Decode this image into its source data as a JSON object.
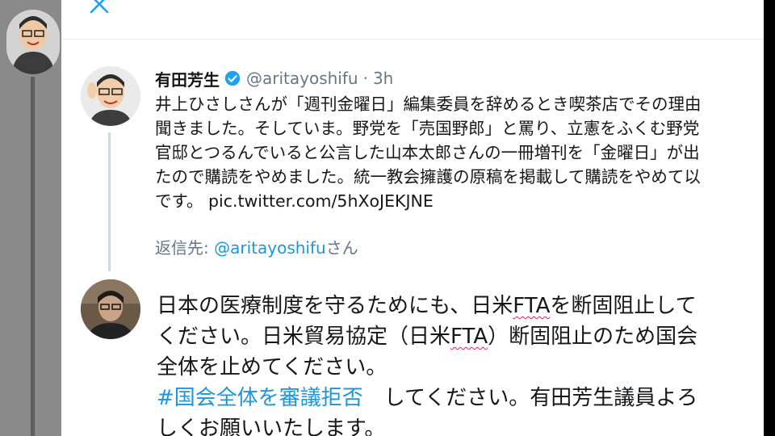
{
  "background": {
    "sidebar_avatar": "cartoon-avatar"
  },
  "modal": {
    "close_icon": "close-icon"
  },
  "tweet": {
    "author_name": "有田芳生",
    "verified_icon": "verified-badge-icon",
    "handle": "@aritayoshifu",
    "separator": "·",
    "time": "3h",
    "lines": [
      "井上ひさしさんが「週刊金曜日」編集委員を辞めるとき喫茶店でその理由",
      "聞きました。そしていま。野党を「売国野郎」と罵り、立憲をふくむ野党",
      "官邸とつるんでいると公言した山本太郎さんの一冊増刊を「金曜日」が出",
      "たので購読をやめました。統一教会擁護の原稿を掲載して購読をやめて以"
    ],
    "last_line_prefix": "です。",
    "link": "pic.twitter.com/5hXoJEKJNE"
  },
  "reply_to": {
    "prefix": "返信先: ",
    "mention": "@aritayoshifu",
    "suffix": "さん"
  },
  "compose": {
    "line1_a": "日本の医療制度を守るためにも、日米",
    "line1_fta": "FTA",
    "line1_b": "を断固阻止して",
    "line2_a": "ください。日米貿易協定（日米",
    "line2_fta": "FTA",
    "line2_b": "）断固阻止のため国会",
    "line3": "全体を止めてください。",
    "hashtag": "#国会全体を審議拒否",
    "line4_b": "　してください。有田芳生議員よろ",
    "line5": "しくお願いいたします。"
  },
  "colors": {
    "link": "#1b95e0",
    "secondary_text": "#657786",
    "primary_text": "#14171a",
    "verified": "#1da1f2",
    "spellcheck": "#e0245e"
  }
}
